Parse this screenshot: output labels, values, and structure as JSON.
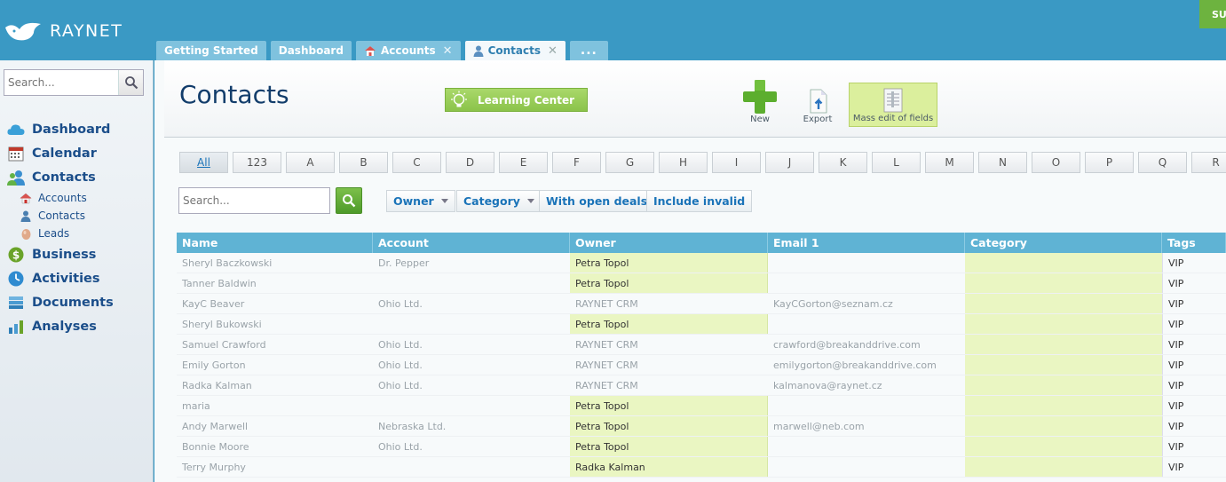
{
  "app": {
    "name": "RAYNET",
    "top_button": "SU"
  },
  "tabs": [
    {
      "label": "Getting Started",
      "icon": "",
      "closable": false,
      "active": false
    },
    {
      "label": "Dashboard",
      "icon": "",
      "closable": false,
      "active": false
    },
    {
      "label": "Accounts",
      "icon": "home-icon",
      "closable": true,
      "active": false
    },
    {
      "label": "Contacts",
      "icon": "person-icon",
      "closable": true,
      "active": true
    },
    {
      "label": "...",
      "icon": "",
      "closable": false,
      "active": false
    }
  ],
  "sidebar": {
    "search_placeholder": "Search...",
    "items": [
      {
        "label": "Dashboard",
        "icon": "cloud-icon"
      },
      {
        "label": "Calendar",
        "icon": "calendar-icon"
      },
      {
        "label": "Contacts",
        "icon": "contacts-icon"
      },
      {
        "label": "Accounts",
        "icon": "home-icon",
        "sub": true
      },
      {
        "label": "Contacts",
        "icon": "person-icon",
        "sub": true
      },
      {
        "label": "Leads",
        "icon": "egg-icon",
        "sub": true
      },
      {
        "label": "Business",
        "icon": "dollar-icon"
      },
      {
        "label": "Activities",
        "icon": "clock-icon"
      },
      {
        "label": "Documents",
        "icon": "documents-icon"
      },
      {
        "label": "Analyses",
        "icon": "chart-icon"
      }
    ]
  },
  "page": {
    "title": "Contacts",
    "learning_center": "Learning Center",
    "tools": {
      "new": "New",
      "export": "Export",
      "mass_edit": "Mass edit of fields"
    }
  },
  "letters": [
    "All",
    "123",
    "A",
    "B",
    "C",
    "D",
    "E",
    "F",
    "G",
    "H",
    "I",
    "J",
    "K",
    "L",
    "M",
    "N",
    "O",
    "P",
    "Q",
    "R"
  ],
  "filters": {
    "search_placeholder": "Search...",
    "owner": "Owner",
    "category": "Category",
    "open_deals": "With open deals",
    "include_invalid": "Include invalid"
  },
  "table": {
    "columns": [
      "Name",
      "Account",
      "Owner",
      "Email 1",
      "Category",
      "Tags"
    ],
    "rows": [
      {
        "name": "Sheryl Baczkowski",
        "account": "Dr. Pepper",
        "owner": "Petra Topol",
        "email": "",
        "category": "",
        "tags": "VIP"
      },
      {
        "name": "Tanner Baldwin",
        "account": "",
        "owner": "Petra Topol",
        "email": "",
        "category": "",
        "tags": "VIP"
      },
      {
        "name": "KayC Beaver",
        "account": "Ohio Ltd.",
        "owner": "RAYNET CRM",
        "email": "KayCGorton@seznam.cz",
        "category": "",
        "tags": "VIP"
      },
      {
        "name": "Sheryl Bukowski",
        "account": "",
        "owner": "Petra Topol",
        "email": "",
        "category": "",
        "tags": "VIP"
      },
      {
        "name": "Samuel Crawford",
        "account": "Ohio Ltd.",
        "owner": "RAYNET CRM",
        "email": "crawford@breakanddrive.com",
        "category": "",
        "tags": "VIP"
      },
      {
        "name": "Emily Gorton",
        "account": "Ohio Ltd.",
        "owner": "RAYNET CRM",
        "email": "emilygorton@breakanddrive.com",
        "category": "",
        "tags": "VIP"
      },
      {
        "name": "Radka Kalman",
        "account": "Ohio Ltd.",
        "owner": "RAYNET CRM",
        "email": "kalmanova@raynet.cz",
        "category": "",
        "tags": "VIP"
      },
      {
        "name": "maria",
        "account": "",
        "owner": "Petra Topol",
        "email": "",
        "category": "",
        "tags": "VIP"
      },
      {
        "name": "Andy Marwell",
        "account": "Nebraska Ltd.",
        "owner": "Petra Topol",
        "email": "marwell@neb.com",
        "category": "",
        "tags": "VIP"
      },
      {
        "name": "Bonnie Moore",
        "account": "Ohio Ltd.",
        "owner": "Petra Topol",
        "email": "",
        "category": "",
        "tags": "VIP"
      },
      {
        "name": "Terry Murphy",
        "account": "",
        "owner": "Radka Kalman",
        "email": "",
        "category": "",
        "tags": "VIP"
      }
    ]
  },
  "colors": {
    "header_blue": "#3a99c4",
    "accent_green": "#8bc34a",
    "table_header": "#5fb3d4",
    "owner_highlight": "#eaf6c2"
  }
}
